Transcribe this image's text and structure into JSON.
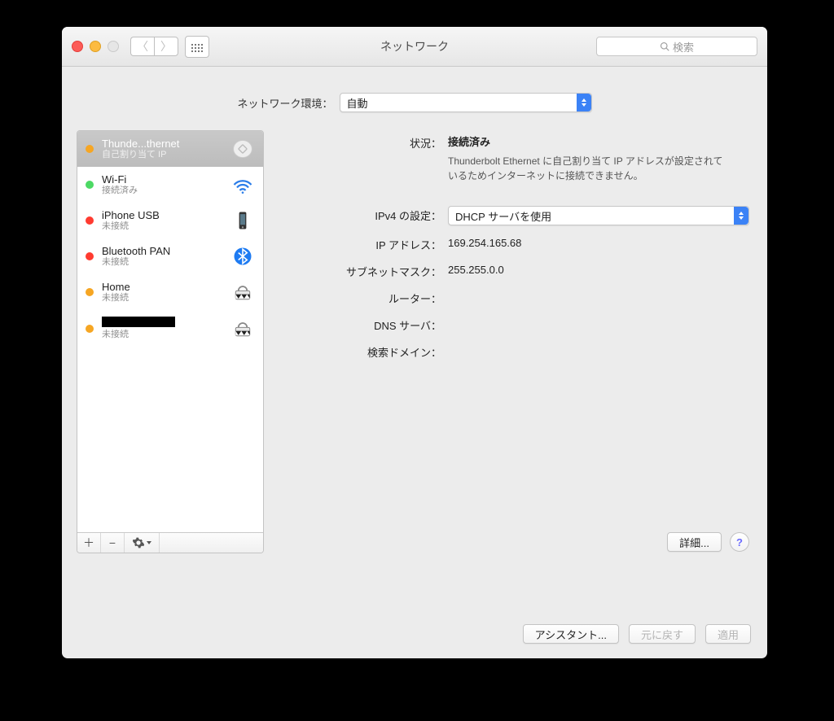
{
  "window": {
    "title": "ネットワーク"
  },
  "search": {
    "placeholder": "検索"
  },
  "location": {
    "label": "ネットワーク環境：",
    "value": "自動"
  },
  "sidebar": {
    "items": [
      {
        "name": "Thunde...thernet",
        "sub": "自己割り当て IP",
        "dot": "orange",
        "active": true
      },
      {
        "name": "Wi-Fi",
        "sub": "接続済み",
        "dot": "green",
        "active": false
      },
      {
        "name": "iPhone USB",
        "sub": "未接続",
        "dot": "red",
        "active": false
      },
      {
        "name": "Bluetooth PAN",
        "sub": "未接続",
        "dot": "red",
        "active": false
      },
      {
        "name": "Home",
        "sub": "未接続",
        "dot": "orange",
        "active": false
      },
      {
        "name": "",
        "sub": "未接続",
        "dot": "orange",
        "active": false,
        "redacted": true
      }
    ]
  },
  "detail": {
    "labels": {
      "status": "状況：",
      "ipv4config": "IPv4 の設定：",
      "ipaddress": "IP アドレス：",
      "subnet": "サブネットマスク：",
      "router": "ルーター：",
      "dns": "DNS サーバ：",
      "searchdomain": "検索ドメイン："
    },
    "status": {
      "value": "接続済み",
      "description": "Thunderbolt Ethernet に自己割り当て IP アドレスが設定されているためインターネットに接続できません。"
    },
    "ipv4config": "DHCP サーバを使用",
    "ipaddress": "169.254.165.68",
    "subnet": "255.255.0.0",
    "router": "",
    "dns": "",
    "searchdomain": ""
  },
  "buttons": {
    "advanced": "詳細...",
    "assistant": "アシスタント...",
    "revert": "元に戻す",
    "apply": "適用"
  }
}
